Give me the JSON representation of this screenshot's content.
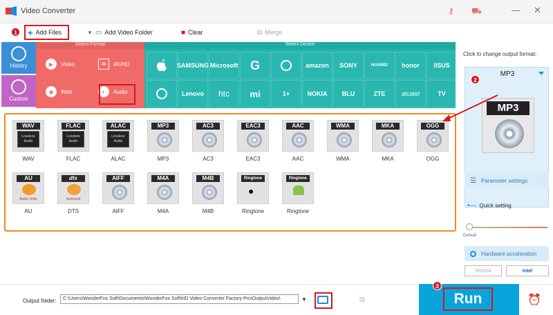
{
  "app": {
    "title": "Video Converter"
  },
  "toolbar": {
    "add_files": "Add Files",
    "add_video_folder": "Add Video Folder",
    "clear": "Clear",
    "merge": "Merge"
  },
  "badges": [
    "1",
    "2",
    "3"
  ],
  "nav": [
    {
      "label": "History",
      "icon": "history-icon"
    },
    {
      "label": "Custom",
      "icon": "custom-icon"
    }
  ],
  "formats": {
    "header": "Select Format",
    "items": [
      {
        "label": "Video"
      },
      {
        "label": "4K/HD",
        "icon_text": "4k"
      },
      {
        "label": "Web"
      },
      {
        "label": "Audio"
      }
    ]
  },
  "devices": {
    "header": "Select Device",
    "items": [
      "",
      "SAMSUNG",
      "Microsoft",
      "G",
      "",
      "amazon",
      "SONY",
      "HUAWEI",
      "honor",
      "/ISUS",
      "",
      "Lenovo",
      "htc",
      "mi",
      "1+",
      "NOKIA",
      "BLU",
      "ZTE",
      "alcatel",
      "TV"
    ]
  },
  "format_grid": [
    {
      "tag": "WAV",
      "name": "WAV",
      "sub": "Lossless Audio"
    },
    {
      "tag": "FLAC",
      "name": "FLAC",
      "sub": "Lossless Audio"
    },
    {
      "tag": "ALAC",
      "name": "ALAC",
      "sub": "Lossless Audio"
    },
    {
      "tag": "MP3",
      "name": "MP3"
    },
    {
      "tag": "AC3",
      "name": "AC3"
    },
    {
      "tag": "EAC3",
      "name": "EAC3"
    },
    {
      "tag": "AAC",
      "name": "AAC"
    },
    {
      "tag": "WMA",
      "name": "WMA"
    },
    {
      "tag": "MKA",
      "name": "MKA"
    },
    {
      "tag": "OGG",
      "name": "OGG"
    },
    {
      "tag": "AU",
      "name": "AU",
      "sub": "Audio Units"
    },
    {
      "tag": "dts",
      "name": "DTS",
      "sub": "Surround"
    },
    {
      "tag": "AIFF",
      "name": "AIFF"
    },
    {
      "tag": "M4A",
      "name": "M4A"
    },
    {
      "tag": "M4B",
      "name": "M4B"
    },
    {
      "tag": "Ringtone",
      "name": "Ringtone",
      "sub": "iPhone"
    },
    {
      "tag": "Ringtone",
      "name": "Ringtone",
      "sub": "Android"
    }
  ],
  "output": {
    "hint": "Click to change output format:",
    "format_name": "MP3",
    "icon_label": "MP3"
  },
  "settings": {
    "parameter": "Parameter settings",
    "quick": "Quick setting",
    "default": "Default",
    "hardware": "Hardware acceleration",
    "nvidia": "NVIDIA",
    "intel": "Intel",
    "quick_level": 0
  },
  "bottom": {
    "output_folder_label": "Output folder:",
    "output_path": "C:\\Users\\WonderFox Soft\\Documents\\WonderFox Soft\\HD Video Converter Factory Pro\\OutputVideo\\",
    "run": "Run"
  },
  "colors": {
    "formats_bg": "#f06a67",
    "devices_bg": "#22b5ad",
    "accent": "#0aa4dd",
    "highlight": "#d6161f",
    "grid_border": "#ef8b16"
  }
}
